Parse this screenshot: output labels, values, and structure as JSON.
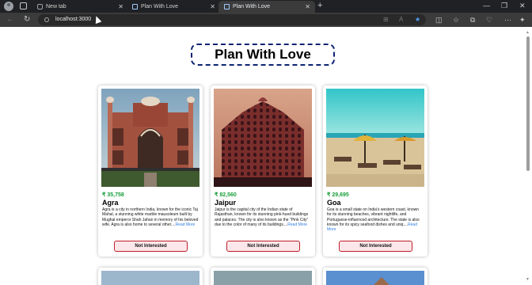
{
  "browser": {
    "tabs": [
      {
        "label": "New tab",
        "active": false
      },
      {
        "label": "Plan With Love",
        "active": false
      },
      {
        "label": "Plan With Love",
        "active": true
      }
    ],
    "url": "localhost:3000"
  },
  "page": {
    "title": "Plan With Love",
    "read_more_label": "Read More",
    "button_label": "Not Interested"
  },
  "cards": [
    {
      "price": "₹ 35,758",
      "name": "Agra",
      "description": "Agra is a city in northern India, known for the iconic Taj Mahal, a stunning white marble mausoleum built by Mughal emperor Shah Jahan in memory of his beloved wife. Agra is also home to several other...."
    },
    {
      "price": "₹ 82,560",
      "name": "Jaipur",
      "description": "Jaipur is the capital city of the Indian state of Rajasthan, known for its stunning pink-hued buildings and palaces. The city is also known as the \"Pink City\" due to the color of many of its buildings...."
    },
    {
      "price": "₹ 29,695",
      "name": "Goa",
      "description": "Goa is a small state on India's western coast, known for its stunning beaches, vibrant nightlife, and Portuguese-influenced architecture. The state is also known for its spicy seafood dishes and uniq...."
    }
  ]
}
